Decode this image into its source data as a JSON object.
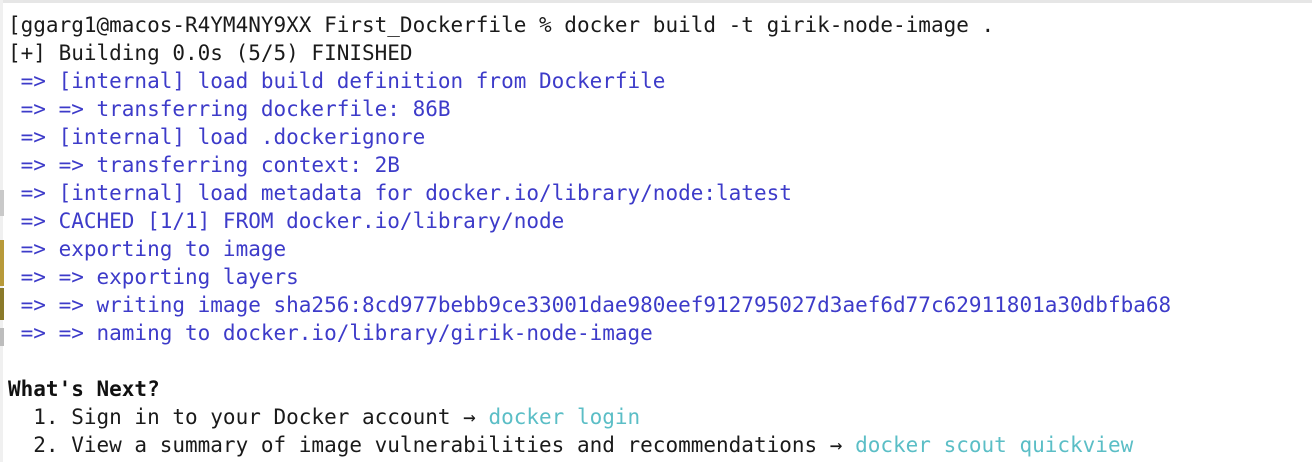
{
  "terminal": {
    "prompt_line": "[ggarg1@macos-R4YM4NY9XX First_Dockerfile % docker build -t girik-node-image .",
    "status_line": "[+] Building 0.0s (5/5) FINISHED",
    "build_steps": [
      " => [internal] load build definition from Dockerfile",
      " => => transferring dockerfile: 86B",
      " => [internal] load .dockerignore",
      " => => transferring context: 2B",
      " => [internal] load metadata for docker.io/library/node:latest",
      " => CACHED [1/1] FROM docker.io/library/node",
      " => exporting to image",
      " => => exporting layers",
      " => => writing image sha256:8cd977bebb9ce33001dae980eef912795027d3aef6d77c62911801a30dbfba68",
      " => => naming to docker.io/library/girik-node-image"
    ],
    "whats_next": {
      "heading": "What's Next?",
      "item1_text": "  1. Sign in to your Docker account → ",
      "item1_cmd": "docker login",
      "item2_text": "  2. View a summary of image vulnerabilities and recommendations → ",
      "item2_cmd": "docker scout quickview"
    }
  },
  "colors": {
    "background": "#ffffff",
    "text": "#1a1a1a",
    "build_step": "#3d3bc9",
    "suggested_command": "#5bbec6"
  }
}
